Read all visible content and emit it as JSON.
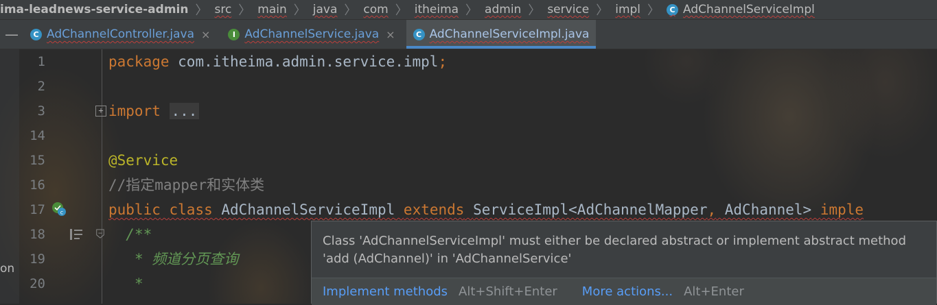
{
  "breadcrumb": {
    "project": "ima-leadnews-service-admin",
    "items": [
      "src",
      "main",
      "java",
      "com",
      "itheima",
      "admin",
      "service",
      "impl"
    ],
    "file": "AdChannelServiceImpl"
  },
  "tabs": [
    {
      "label": "AdChannelController.java",
      "icon": "class-icon",
      "active": false
    },
    {
      "label": "AdChannelService.java",
      "icon": "interface-icon",
      "active": false
    },
    {
      "label": "AdChannelServiceImpl.java",
      "icon": "class-icon",
      "active": true
    }
  ],
  "icons": {
    "class_letter": "C",
    "interface_letter": "I",
    "close": "×",
    "collapse": "—",
    "fold_plus": "+",
    "fold_minus": "−"
  },
  "editor": {
    "lines": [
      {
        "n": "1",
        "package_kw": "package",
        "package_name": " com.itheima.admin.service.impl",
        "semi": ";"
      },
      {
        "n": "2"
      },
      {
        "n": "3",
        "import_kw": "import",
        "folded": "..."
      },
      {
        "n": "14"
      },
      {
        "n": "15",
        "annotation": "@Service"
      },
      {
        "n": "16",
        "comment": "//指定mapper和实体类"
      },
      {
        "n": "17",
        "public_kw": "public",
        "class_kw": "class",
        "class_name": "AdChannelServiceImpl",
        "extends_kw": "extends",
        "super_type": "ServiceImpl<AdChannelMapper",
        "comma": ",",
        "generic2": " AdChannel>",
        "implements_kw": "imple"
      },
      {
        "n": "18",
        "doc_start": "/**"
      },
      {
        "n": "19",
        "doc_star": "*",
        "doc_text": "频道分页查询"
      },
      {
        "n": "20",
        "doc_star": "*"
      }
    ]
  },
  "left_clip_text": "on",
  "popup": {
    "message": "Class 'AdChannelServiceImpl' must either be declared abstract or implement abstract method 'add (AdChannel)' in 'AdChannelService'",
    "action1": "Implement methods",
    "shortcut1": "Alt+Shift+Enter",
    "action2": "More actions...",
    "shortcut2": "Alt+Enter"
  }
}
